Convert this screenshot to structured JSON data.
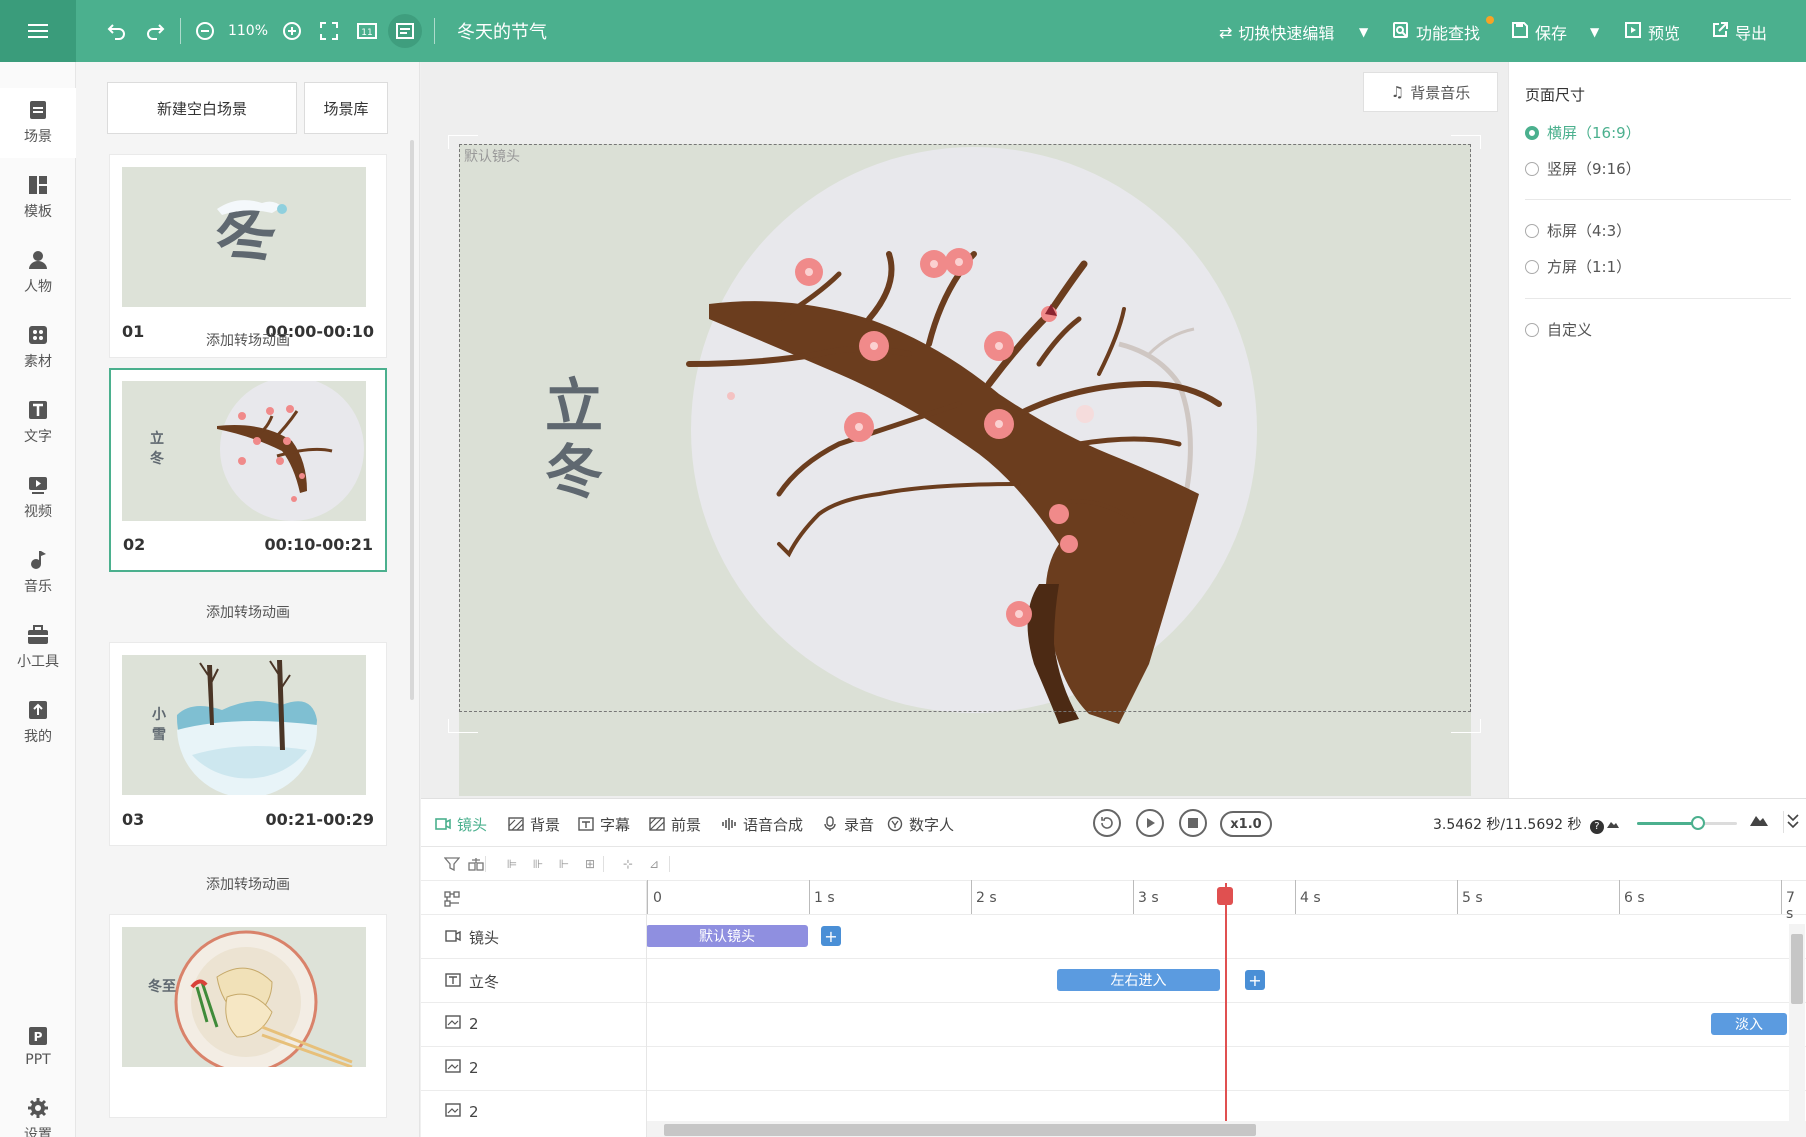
{
  "toolbar": {
    "zoom": "110%",
    "title": "冬天的节气",
    "switch_label": "切换快速编辑",
    "find_label": "功能查找",
    "save_label": "保存",
    "preview_label": "预览",
    "export_label": "导出",
    "page_counter": "11"
  },
  "rail": {
    "items": [
      {
        "label": "场景",
        "icon": "scene-icon"
      },
      {
        "label": "模板",
        "icon": "template-icon"
      },
      {
        "label": "人物",
        "icon": "person-icon"
      },
      {
        "label": "素材",
        "icon": "material-icon"
      },
      {
        "label": "文字",
        "icon": "text-icon"
      },
      {
        "label": "视频",
        "icon": "video-icon"
      },
      {
        "label": "音乐",
        "icon": "music-icon"
      },
      {
        "label": "小工具",
        "icon": "toolbox-icon"
      },
      {
        "label": "我的",
        "icon": "upload-icon"
      }
    ],
    "ppt_label": "PPT",
    "settings_label": "设置"
  },
  "scenes": {
    "new_label": "新建空白场景",
    "library_label": "场景库",
    "transition_label": "添加转场动画",
    "cards": [
      {
        "num": "01",
        "time": "00:00-00:10",
        "thumb_text": "冬"
      },
      {
        "num": "02",
        "time": "00:10-00:21",
        "thumb_text": "立冬"
      },
      {
        "num": "03",
        "time": "00:21-00:29",
        "thumb_text": "小雪"
      },
      {
        "num": "",
        "time": "",
        "thumb_text": "冬至"
      }
    ]
  },
  "stage": {
    "bgm_label": "背景音乐",
    "lens_label": "默认镜头",
    "canvas_text_1": "立",
    "canvas_text_2": "冬"
  },
  "props": {
    "title": "页面尺寸",
    "options": [
      {
        "label": "横屏（16:9）",
        "selected": true
      },
      {
        "label": "竖屏（9:16）",
        "selected": false
      },
      {
        "label": "标屏（4:3）",
        "selected": false
      },
      {
        "label": "方屏（1:1）",
        "selected": false
      },
      {
        "label": "自定义",
        "selected": false
      }
    ]
  },
  "timeline": {
    "tabs": [
      {
        "label": "镜头",
        "active": true
      },
      {
        "label": "背景",
        "active": false
      },
      {
        "label": "字幕",
        "active": false
      },
      {
        "label": "前景",
        "active": false
      },
      {
        "label": "语音合成",
        "active": false
      },
      {
        "label": "录音",
        "active": false
      },
      {
        "label": "数字人",
        "active": false
      }
    ],
    "speed": "x1.0",
    "time_info": "3.5462 秒/11.5692 秒",
    "ruler": [
      "0",
      "1 s",
      "2 s",
      "3 s",
      "4 s",
      "5 s",
      "6 s",
      "7 s"
    ],
    "tracks": [
      {
        "name": "镜头",
        "clip": "默认镜头"
      },
      {
        "name": "立冬",
        "clip": "左右进入"
      },
      {
        "name": "2",
        "clip": "淡入"
      },
      {
        "name": "2",
        "clip": ""
      },
      {
        "name": "2",
        "clip": ""
      }
    ]
  },
  "colors": {
    "brand": "#4bb08e",
    "lens_clip": "#8f8fe0",
    "text_clip": "#5b9be0",
    "playhead": "#e05050"
  }
}
